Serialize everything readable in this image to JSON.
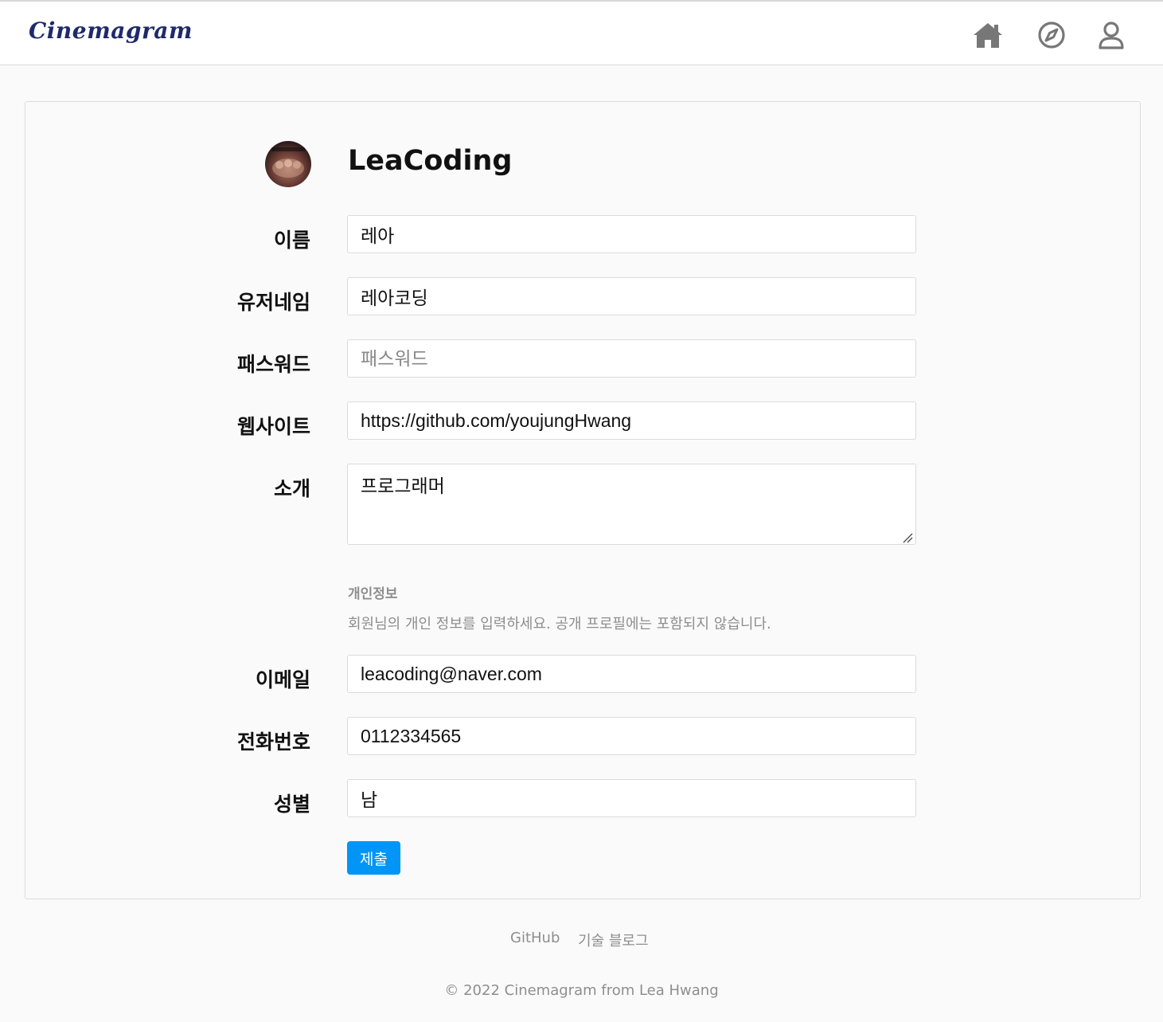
{
  "header": {
    "logo": "Cinemagram",
    "nav": [
      "home-icon",
      "compass-icon",
      "user-icon"
    ]
  },
  "profile": {
    "username": "LeaCoding"
  },
  "form": {
    "name": {
      "label": "이름",
      "value": "레아"
    },
    "username": {
      "label": "유저네임",
      "value": "레아코딩"
    },
    "password": {
      "label": "패스워드",
      "placeholder": "패스워드"
    },
    "website": {
      "label": "웹사이트",
      "value": "https://github.com/youjungHwang"
    },
    "bio": {
      "label": "소개",
      "value": "프로그래머"
    },
    "private_section": {
      "title": "개인정보",
      "description": "회원님의 개인 정보를 입력하세요. 공개 프로필에는 포함되지 않습니다."
    },
    "email": {
      "label": "이메일",
      "value": "leacoding@naver.com"
    },
    "phone": {
      "label": "전화번호",
      "value": "0112334565"
    },
    "gender": {
      "label": "성별",
      "value": "남"
    },
    "submit_label": "제출"
  },
  "footer": {
    "links": [
      "GitHub",
      "기술 블로그"
    ],
    "copyright": "© 2022 Cinemagram from Lea Hwang"
  },
  "colors": {
    "primary_button": "#0095f6",
    "logo": "#1f2a6b",
    "icon": "#777777",
    "muted_text": "#8e8e8e"
  }
}
